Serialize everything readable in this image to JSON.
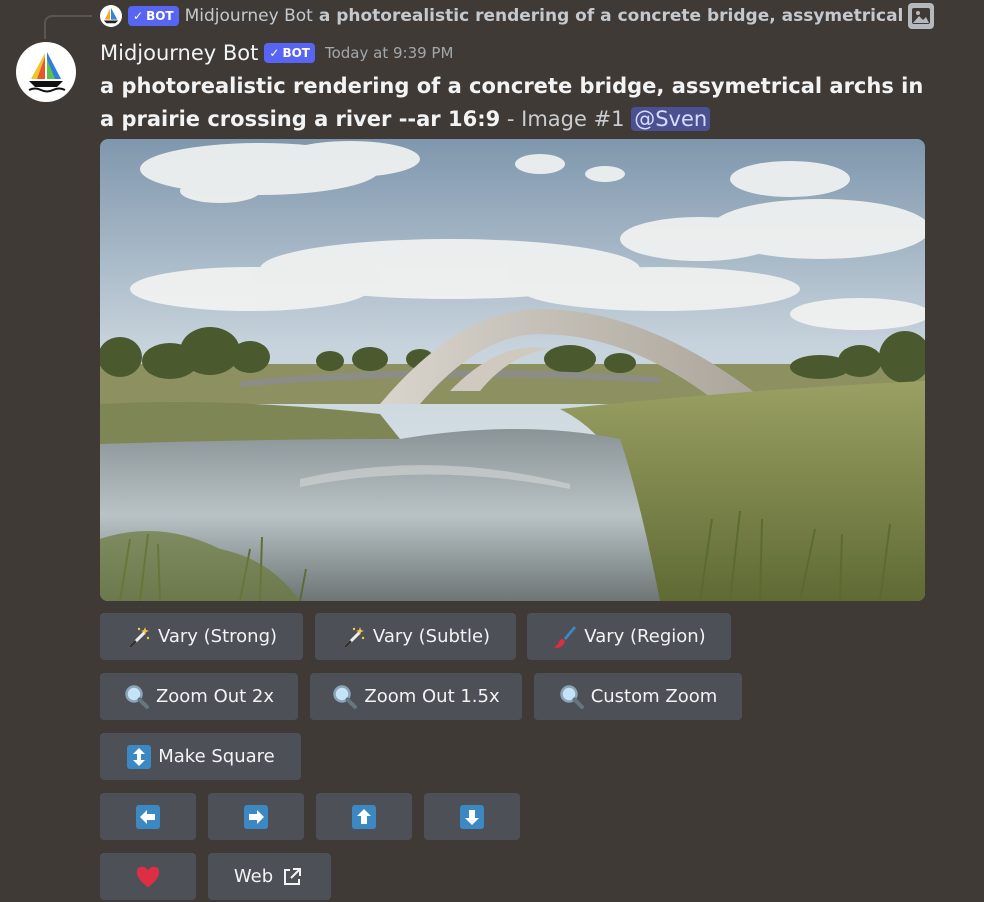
{
  "reply": {
    "badge": "BOT",
    "author": "Midjourney Bot",
    "text": "a photorealistic rendering of a concrete bridge, assymetrical"
  },
  "message": {
    "author": "Midjourney Bot",
    "badge": "BOT",
    "timestamp": "Today at 9:39 PM",
    "prompt": "a photorealistic rendering of a concrete bridge, assymetrical archs in a prairie crossing a river --ar 16:9",
    "suffix": " - Image #1 ",
    "mention": "@Sven"
  },
  "buttons": {
    "vary_strong": "Vary (Strong)",
    "vary_subtle": "Vary (Subtle)",
    "vary_region": "Vary (Region)",
    "zoom_out_2x": "Zoom Out 2x",
    "zoom_out_1_5x": "Zoom Out 1.5x",
    "custom_zoom": "Custom Zoom",
    "make_square": "Make Square",
    "web": "Web"
  },
  "icons": {
    "vary": "magic-wand-icon",
    "region": "paintbrush-icon",
    "zoom": "magnifier-icon",
    "square": "up-down-arrow-icon",
    "pan_left": "arrow-left-icon",
    "pan_right": "arrow-right-icon",
    "pan_up": "arrow-up-icon",
    "pan_down": "arrow-down-icon",
    "favorite": "heart-icon",
    "external": "external-link-icon"
  },
  "colors": {
    "background": "#3f3a35",
    "button": "#4e5058",
    "badge": "#5865f2",
    "mention": "#4b5091",
    "heart": "#dd2e44",
    "arrow_tile": "#3b88c3"
  }
}
